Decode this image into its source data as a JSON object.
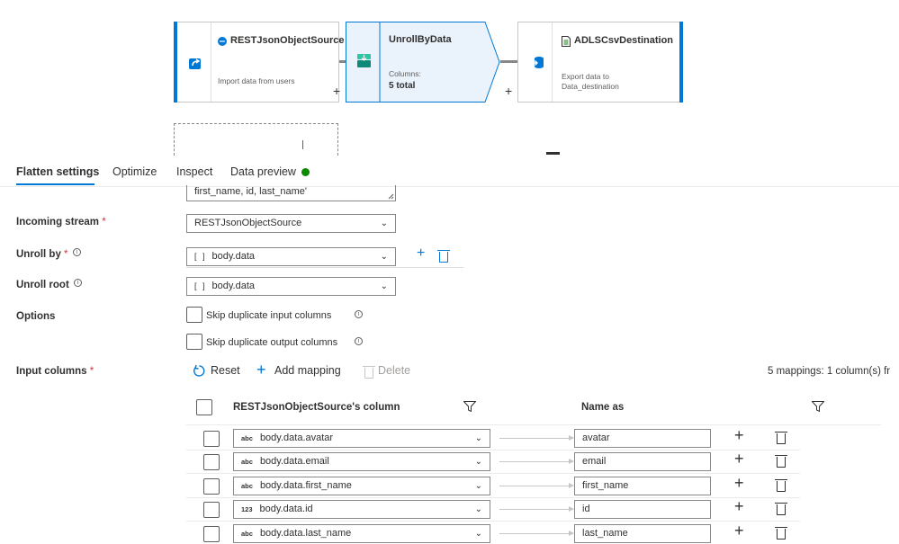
{
  "canvas": {
    "nodes": [
      {
        "title": "RESTJsonObjectSource",
        "description": "Import data from users"
      },
      {
        "title": "UnrollByData",
        "desc_label": "Columns:",
        "desc_value": "5 total"
      },
      {
        "title": "ADLSCsvDestination",
        "description_line1": "Export data to",
        "description_line2": "Data_destination"
      }
    ],
    "plus": "+"
  },
  "tabs": [
    {
      "label": "Flatten settings"
    },
    {
      "label": "Optimize"
    },
    {
      "label": "Inspect"
    },
    {
      "label": "Data preview"
    }
  ],
  "form": {
    "expression_text": "first_name, id, last_name'",
    "incoming_stream": {
      "label": "Incoming stream",
      "required": "*",
      "value": "RESTJsonObjectSource"
    },
    "unroll_by": {
      "label": "Unroll by",
      "required": "*",
      "value": "body.data",
      "type_glyph": "[ ]"
    },
    "unroll_root": {
      "label": "Unroll root",
      "value": "body.data",
      "type_glyph": "[ ]"
    },
    "options": {
      "label": "Options",
      "skip_input": "Skip duplicate input columns",
      "skip_output": "Skip duplicate output columns"
    },
    "input_columns": {
      "label": "Input columns",
      "required": "*"
    }
  },
  "toolbar": {
    "reset": "Reset",
    "add_mapping": "Add mapping",
    "delete": "Delete",
    "summary": "5 mappings: 1 column(s) fr"
  },
  "mapping": {
    "col_source": "RESTJsonObjectSource's column",
    "col_name_as": "Name as",
    "rows": [
      {
        "type": "abc",
        "source": "body.data.avatar",
        "name_as": "avatar"
      },
      {
        "type": "abc",
        "source": "body.data.email",
        "name_as": "email"
      },
      {
        "type": "abc",
        "source": "body.data.first_name",
        "name_as": "first_name"
      },
      {
        "type": "123",
        "source": "body.data.id",
        "name_as": "id"
      },
      {
        "type": "abc",
        "source": "body.data.last_name",
        "name_as": "last_name"
      }
    ]
  },
  "colors": {
    "accent": "#0078d4",
    "required": "#d13438",
    "status_dot": "#0b8a00",
    "selected_node_bg": "#eaf3fc"
  }
}
